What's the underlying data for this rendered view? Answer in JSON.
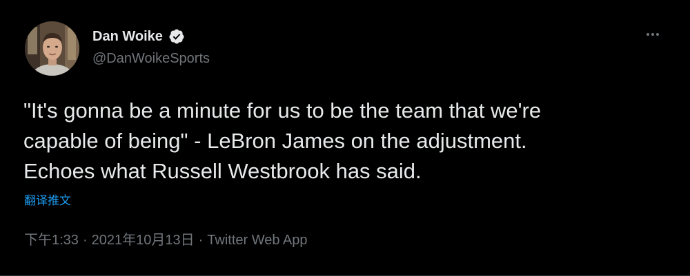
{
  "author": {
    "display_name": "Dan Woike",
    "handle": "@DanWoikeSports",
    "verified": true,
    "verified_color": "#1d9bf0"
  },
  "icons": {
    "avatar": "profile-photo",
    "verified": "verified-badge-icon",
    "more": "more-horizontal-icon"
  },
  "tweet": {
    "text_lines": [
      "\"It's gonna be a minute for us to be the team that we're",
      "capable of being\" - LeBron James on the adjustment.",
      "Echoes what Russell Westbrook has said."
    ],
    "translate_label": "翻译推文"
  },
  "meta": {
    "time": "下午1:33",
    "separator": "·",
    "date": "2021年10月13日",
    "source": "Twitter Web App"
  },
  "colors": {
    "background": "#000000",
    "text_primary": "#e7e9ea",
    "text_secondary": "#71767b",
    "accent": "#1d9bf0"
  }
}
